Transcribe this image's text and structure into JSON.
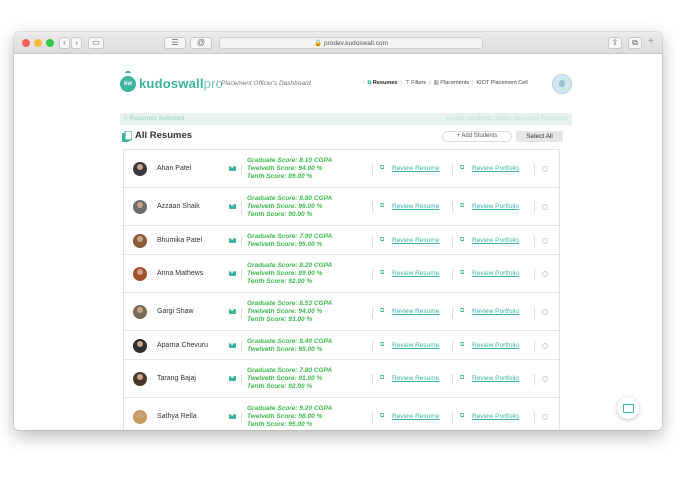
{
  "browser": {
    "url": "prodev.kudoswall.com",
    "tab_button_label": "☰",
    "reader_icon": "@"
  },
  "header": {
    "brand_main": "kudoswall",
    "brand_suffix": "pro",
    "logo_initials": "kw",
    "dashboard_title": "Placement Officer's Dashboard",
    "nav": {
      "resumes": "Resumes",
      "filters": "Filters",
      "placements": "Placements",
      "cell": "KIOT Placement Cell"
    }
  },
  "selection_bar": {
    "count_text": "0 Resumes Selected",
    "actions_text": "Delete Students  Share Selected Resumes"
  },
  "list_header": {
    "title": "All Resumes",
    "add_students": "+ Add Students",
    "select_all": "Select All"
  },
  "links": {
    "review_resume": "Review Resume",
    "review_portfolio": "Review Portfolio"
  },
  "students": [
    {
      "name": "Ahan Patel",
      "scores": [
        "Graduate Score: 8.10 CGPA",
        "Twelveth Score: 94.00 %",
        "Tenth Score: 89.00 %"
      ]
    },
    {
      "name": "Azzaan Shaik",
      "scores": [
        "Graduate Score: 8.80 CGPA",
        "Twelveth Score: 96.00 %",
        "Tenth Score: 90.00 %"
      ]
    },
    {
      "name": "Bhumika Patel",
      "scores": [
        "Graduate Score: 7.90 CGPA",
        "Twelveth Score: 95.00 %"
      ]
    },
    {
      "name": "Anna Mathews",
      "scores": [
        "Graduate Score: 8.20 CGPA",
        "Twelveth Score: 89.00 %",
        "Tenth Score: 92.00 %"
      ]
    },
    {
      "name": "Gargi Shaw",
      "scores": [
        "Graduate Score: 8.53 CGPA",
        "Twelveth Score: 94.00 %",
        "Tenth Score: 93.00 %"
      ]
    },
    {
      "name": "Aparna Chevuru",
      "scores": [
        "Graduate Score: 8.40 CGPA",
        "Twelveth Score: 95.00 %"
      ]
    },
    {
      "name": "Tarang Bajaj",
      "scores": [
        "Graduate Score: 7.80 CGPA",
        "Twelveth Score: 91.00 %",
        "Tenth Score: 92.00 %"
      ]
    },
    {
      "name": "Sathya Rella",
      "scores": [
        "Graduate Score: 9.20 CGPA",
        "Twelveth Score: 98.00 %",
        "Tenth Score: 95.00 %"
      ]
    }
  ],
  "colors": {
    "brand": "#3bb39d",
    "score_green": "#3dbb4c",
    "selection_bar_bg": "#e8f3f0"
  }
}
